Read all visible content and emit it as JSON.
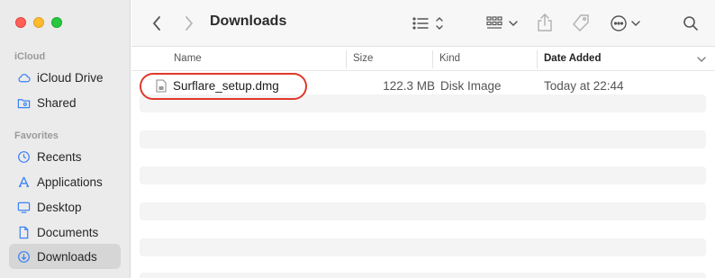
{
  "window": {
    "title": "Downloads"
  },
  "sidebar": {
    "sections": [
      {
        "heading": "iCloud",
        "items": [
          {
            "label": "iCloud Drive",
            "icon": "cloud-icon"
          },
          {
            "label": "Shared",
            "icon": "shared-folder-icon"
          }
        ]
      },
      {
        "heading": "Favorites",
        "items": [
          {
            "label": "Recents",
            "icon": "clock-icon"
          },
          {
            "label": "Applications",
            "icon": "applications-icon"
          },
          {
            "label": "Desktop",
            "icon": "desktop-icon"
          },
          {
            "label": "Documents",
            "icon": "document-icon"
          },
          {
            "label": "Downloads",
            "icon": "download-icon",
            "selected": true
          }
        ]
      }
    ]
  },
  "columns": {
    "name": "Name",
    "size": "Size",
    "kind": "Kind",
    "date": "Date Added"
  },
  "files": [
    {
      "name": "Surflare_setup.dmg",
      "size": "122.3 MB",
      "kind": "Disk Image",
      "date": "Today at 22:44"
    }
  ],
  "colors": {
    "highlight": "#e0392b",
    "sidebar": "#ebebeb",
    "selected": "#d6d6d6"
  }
}
